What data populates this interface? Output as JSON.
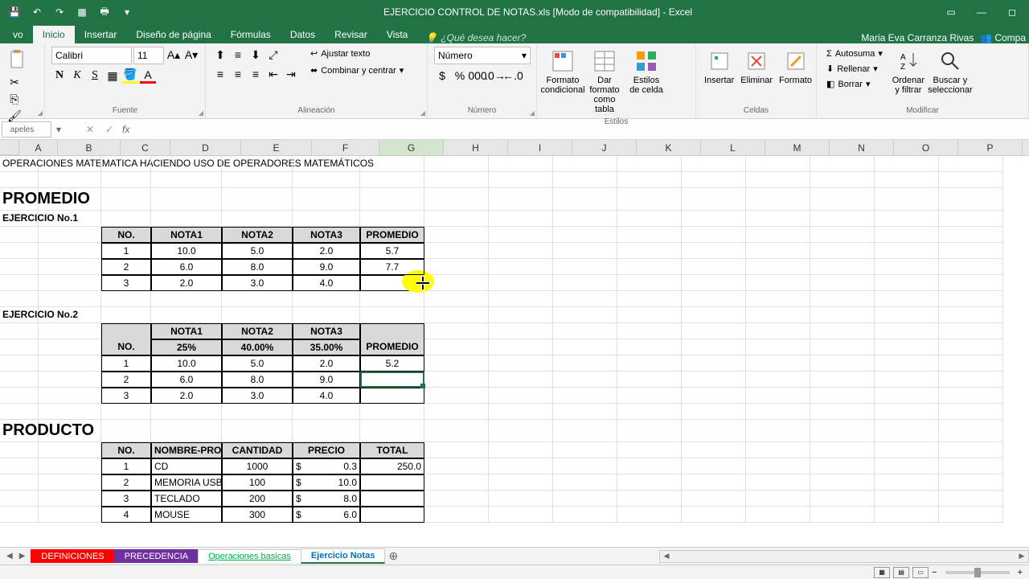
{
  "title": "EJERCICIO CONTROL DE NOTAS.xls  [Modo de compatibilidad] - Excel",
  "user": "Maria Eva Carranza Rivas",
  "share": "Compa",
  "tabs": [
    "vo",
    "Inicio",
    "Insertar",
    "Diseño de página",
    "Fórmulas",
    "Datos",
    "Revisar",
    "Vista"
  ],
  "active_tab": 1,
  "tell_me": "¿Qué desea hacer?",
  "ribbon": {
    "clipboard": {
      "label": "apeles"
    },
    "font": {
      "label": "Fuente",
      "name": "Calibri",
      "size": "11",
      "bold": "N",
      "italic": "K",
      "underline": "S"
    },
    "align": {
      "label": "Alineación",
      "wrap": "Ajustar texto",
      "merge": "Combinar y centrar"
    },
    "number": {
      "label": "Número",
      "format": "Número"
    },
    "styles": {
      "label": "Estilos",
      "cond": "Formato condicional",
      "table": "Dar formato como tabla",
      "cell": "Estilos de celda"
    },
    "cells": {
      "label": "Celdas",
      "insert": "Insertar",
      "delete": "Eliminar",
      "format": "Formato"
    },
    "editing": {
      "label": "Modificar",
      "sum": "Autosuma",
      "fill": "Rellenar",
      "clear": "Borrar",
      "sort": "Ordenar y filtrar",
      "find": "Buscar y seleccionar"
    }
  },
  "formula_bar": {
    "name_box": "",
    "formula": ""
  },
  "columns": [
    "A",
    "B",
    "C",
    "D",
    "E",
    "F",
    "G",
    "H",
    "I",
    "J",
    "K",
    "L",
    "M",
    "N",
    "O",
    "P"
  ],
  "selected_col": "G",
  "sheet": {
    "title_row": "OPERACIONES MATEMATICA HACIENDO USO DE OPERADORES MATEMÁTICOS",
    "promedio_hdr": "PROMEDIO",
    "ej1": "EJERCICIO No.1",
    "t1_headers": [
      "NO.",
      "NOTA1",
      "NOTA2",
      "NOTA3",
      "PROMEDIO"
    ],
    "t1_rows": [
      [
        "1",
        "10.0",
        "5.0",
        "2.0",
        "5.7"
      ],
      [
        "2",
        "6.0",
        "8.0",
        "9.0",
        "7.7"
      ],
      [
        "3",
        "2.0",
        "3.0",
        "4.0",
        ""
      ]
    ],
    "ej2": "EJERCICIO No.2",
    "t2_h1": [
      "NOTA1",
      "NOTA2",
      "NOTA3"
    ],
    "t2_no": "NO.",
    "t2_prom": "PROMEDIO",
    "t2_pct": [
      "25%",
      "40.00%",
      "35.00%"
    ],
    "t2_rows": [
      [
        "1",
        "10.0",
        "5.0",
        "2.0",
        "5.2"
      ],
      [
        "2",
        "6.0",
        "8.0",
        "9.0",
        ""
      ],
      [
        "3",
        "2.0",
        "3.0",
        "4.0",
        ""
      ]
    ],
    "producto_hdr": "PRODUCTO",
    "t3_headers": [
      "NO.",
      "NOMBRE-PROD",
      "CANTIDAD",
      "PRECIO",
      "TOTAL"
    ],
    "t3_rows": [
      [
        "1",
        "CD",
        "1000",
        "$",
        "0.3",
        "250.0"
      ],
      [
        "2",
        "MEMORIA USB",
        "100",
        "$",
        "10.0",
        ""
      ],
      [
        "3",
        "TECLADO",
        "200",
        "$",
        "8.0",
        ""
      ],
      [
        "4",
        "MOUSE",
        "300",
        "$",
        "6.0",
        ""
      ]
    ]
  },
  "sheet_tabs": [
    "DEFINICIONES",
    "PRECEDENCIA",
    "Operaciones basicas",
    "Ejercicio Notas"
  ],
  "active_sheet": 3,
  "chart_data": null
}
